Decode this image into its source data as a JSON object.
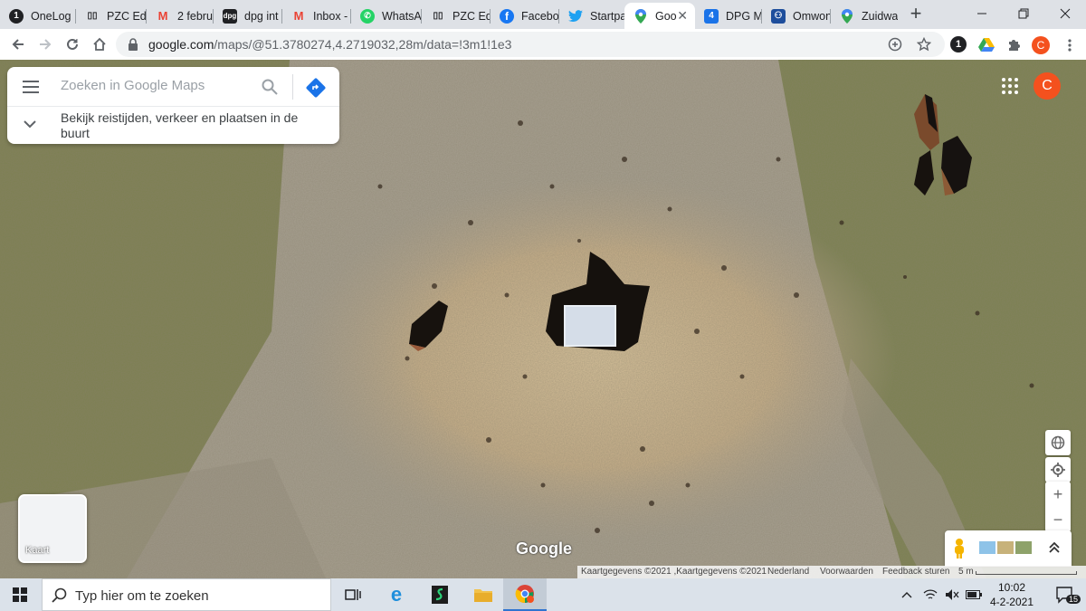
{
  "browser": {
    "tabs": [
      {
        "label": "OneLog",
        "icon": "onelogin-icon"
      },
      {
        "label": "PZC Edi",
        "icon": "pzc-icon"
      },
      {
        "label": "2 februa",
        "icon": "gmail-icon"
      },
      {
        "label": "dpg int",
        "icon": "dpg-icon"
      },
      {
        "label": "Inbox -",
        "icon": "gmail-icon"
      },
      {
        "label": "WhatsA",
        "icon": "whatsapp-icon"
      },
      {
        "label": "PZC Edi",
        "icon": "pzc-icon"
      },
      {
        "label": "Facebo",
        "icon": "facebook-icon"
      },
      {
        "label": "Startpa",
        "icon": "twitter-icon"
      },
      {
        "label": "Goo",
        "icon": "google-maps-icon",
        "active": true
      },
      {
        "label": "DPG M",
        "icon": "dpg-m-icon"
      },
      {
        "label": "Omwon",
        "icon": "omwonenden-icon"
      },
      {
        "label": "Zuidwa",
        "icon": "google-maps-icon"
      }
    ],
    "url_host": "google.com",
    "url_path": "/maps/@51.3780274,4.2719032,28m/data=!3m1!1e3",
    "extension_badge": "1",
    "profile_initial": "C",
    "accent_color": "#1a73e8"
  },
  "maps": {
    "search_placeholder": "Zoeken in Google Maps",
    "explore_text": "Bekijk reistijden, verkeer en plaatsen in de buurt",
    "profile_initial": "C",
    "minimap_label": "Kaart",
    "logo_text": "Google",
    "attribution": {
      "data": "Kaartgegevens ©2021 ,Kaartgegevens ©2021",
      "country": "Nederland",
      "terms": "Voorwaarden",
      "feedback": "Feedback sturen",
      "scale": "5 m"
    }
  },
  "taskbar": {
    "search_placeholder": "Typ hier om te zoeken",
    "time": "10:02",
    "date": "4-2-2021",
    "notification_count": "15"
  }
}
